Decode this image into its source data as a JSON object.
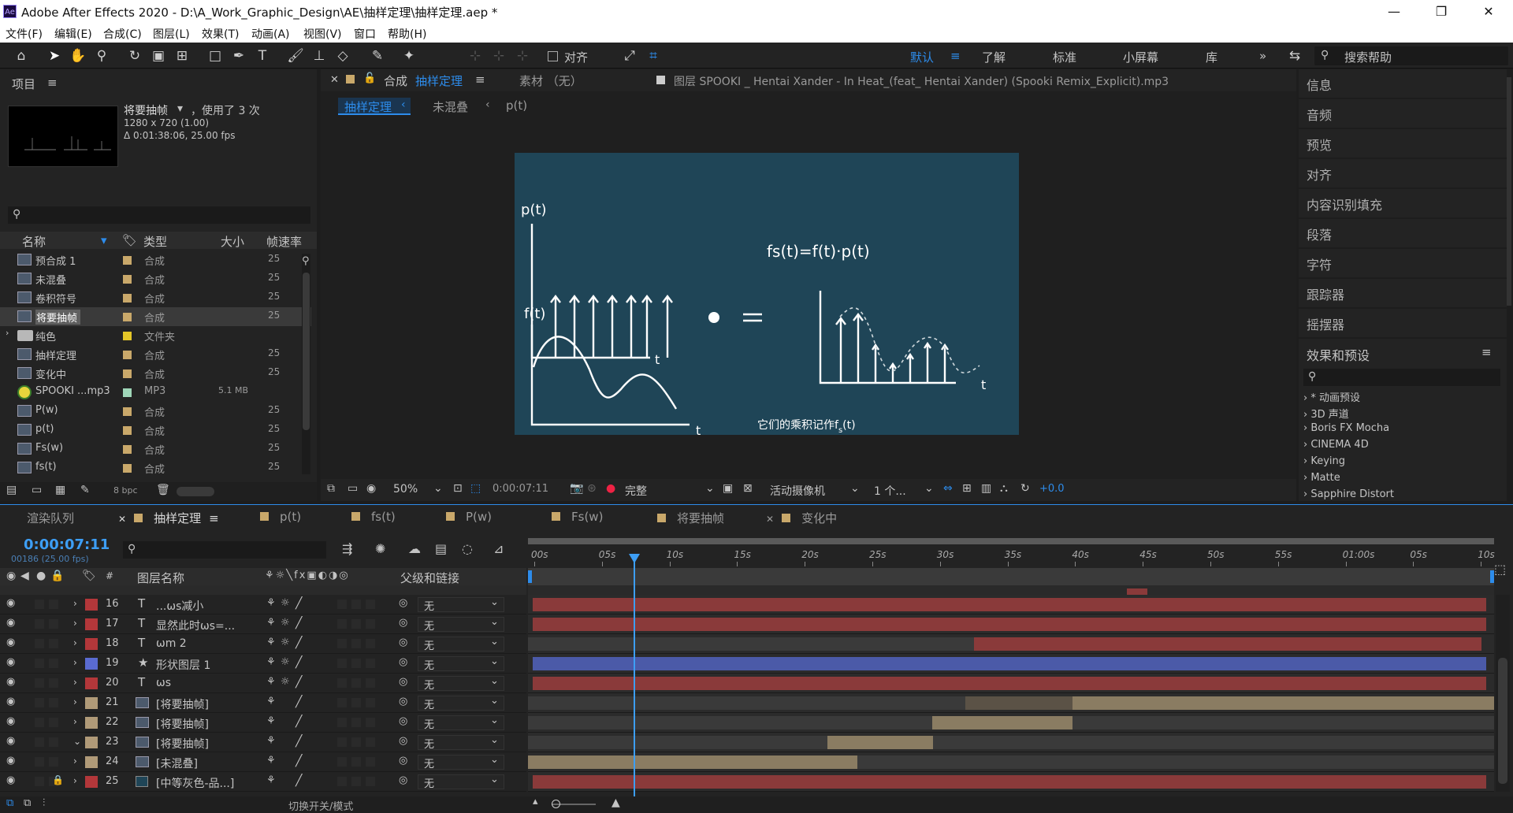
{
  "window": {
    "title": "Adobe After Effects 2020 - D:\\A_Work_Graphic_Design\\AE\\抽样定理\\抽样定理.aep *",
    "logo": "Ae"
  },
  "menu": [
    "文件(F)",
    "编辑(E)",
    "合成(C)",
    "图层(L)",
    "效果(T)",
    "动画(A)",
    "视图(V)",
    "窗口",
    "帮助(H)"
  ],
  "toolbar": {
    "align_label": "对齐",
    "workspaces": [
      "默认",
      "了解",
      "标准",
      "小屏幕",
      "库"
    ],
    "active_workspace": "默认",
    "search_placeholder": "搜索帮助"
  },
  "project": {
    "panel_title": "项目",
    "selected_name": "将要抽帧",
    "used": "，使用了 3 次",
    "resolution": "1280 x 720 (1.00)",
    "duration": "Δ 0:01:38:06, 25.00 fps",
    "columns": {
      "name": "名称",
      "type": "类型",
      "size": "大小",
      "fps": "帧速率"
    },
    "items": [
      {
        "name": "预合成 1",
        "type": "合成",
        "size": "",
        "fps": "25",
        "color": "#c9a86a",
        "icon": "comp"
      },
      {
        "name": "未混叠",
        "type": "合成",
        "size": "",
        "fps": "25",
        "color": "#c9a86a",
        "icon": "comp"
      },
      {
        "name": "卷积符号",
        "type": "合成",
        "size": "",
        "fps": "25",
        "color": "#c9a86a",
        "icon": "comp"
      },
      {
        "name": "将要抽帧",
        "type": "合成",
        "size": "",
        "fps": "25",
        "color": "#c9a86a",
        "icon": "comp",
        "selected": true
      },
      {
        "name": "纯色",
        "type": "文件夹",
        "size": "",
        "fps": "",
        "color": "#e4c628",
        "icon": "folder"
      },
      {
        "name": "抽样定理",
        "type": "合成",
        "size": "",
        "fps": "25",
        "color": "#c9a86a",
        "icon": "comp"
      },
      {
        "name": "变化中",
        "type": "合成",
        "size": "",
        "fps": "25",
        "color": "#c9a86a",
        "icon": "comp"
      },
      {
        "name": "SPOOKI ...mp3",
        "type": "MP3",
        "size": "5.1 MB",
        "fps": "",
        "color": "#9fd6b8",
        "icon": "audio"
      },
      {
        "name": "P(w)",
        "type": "合成",
        "size": "",
        "fps": "25",
        "color": "#c9a86a",
        "icon": "comp"
      },
      {
        "name": "p(t)",
        "type": "合成",
        "size": "",
        "fps": "25",
        "color": "#c9a86a",
        "icon": "comp"
      },
      {
        "name": "Fs(w)",
        "type": "合成",
        "size": "",
        "fps": "25",
        "color": "#c9a86a",
        "icon": "comp"
      },
      {
        "name": "fs(t)",
        "type": "合成",
        "size": "",
        "fps": "25",
        "color": "#c9a86a",
        "icon": "comp"
      }
    ],
    "bpc": "8 bpc"
  },
  "viewer": {
    "comp_tab_prefix": "合成",
    "comp_tab_name": "抽样定理",
    "footage_tab": "素材 （无）",
    "layer_tab": "图层 SPOOKI _ Hentai Xander - In Heat_(feat_ Hentai Xander) (Spooki Remix_Explicit).mp3",
    "breadcrumbs": [
      "抽样定理",
      "未混叠",
      "p(t)"
    ],
    "zoom": "50%",
    "timecode": "0:00:07:11",
    "quality": "完整",
    "camera": "活动摄像机",
    "views": "1 个...",
    "exposure": "+0.0"
  },
  "artwork": {
    "label_pt": "p(t)",
    "label_ft": "f(t)",
    "axis_t": "t",
    "formula": "fs(t)=f(t)·p(t)",
    "dot": "●",
    "equals": "=",
    "caption": "它们的乘积记作f",
    "caption_sub": "s",
    "caption_end": "(t)"
  },
  "right_panels": [
    "信息",
    "音频",
    "预览",
    "对齐",
    "内容识别填充",
    "段落",
    "字符",
    "跟踪器",
    "摇摆器"
  ],
  "effects": {
    "title": "效果和预设",
    "items": [
      "* 动画预设",
      "3D 声道",
      "Boris FX Mocha",
      "CINEMA 4D",
      "Keying",
      "Matte",
      "Sapphire Distort"
    ]
  },
  "timeline": {
    "tabs": [
      "渲染队列",
      "抽样定理",
      "p(t)",
      "fs(t)",
      "P(w)",
      "Fs(w)",
      "将要抽帧",
      "变化中"
    ],
    "active_tab": "抽样定理",
    "timecode": "0:00:07:11",
    "frame_info": "00186 (25.00 fps)",
    "col_layer": "图层名称",
    "col_parent": "父级和链接",
    "toggle_label": "切换开关/模式",
    "ruler": [
      "00s",
      "05s",
      "10s",
      "15s",
      "20s",
      "25s",
      "30s",
      "35s",
      "40s",
      "45s",
      "50s",
      "55s",
      "01:00s",
      "05s",
      "10s"
    ],
    "layers": [
      {
        "num": "16",
        "type": "T",
        "name": "...ωs减小",
        "label": "#b3373a",
        "parent": "无",
        "bar_color": "#8a3a3a"
      },
      {
        "num": "17",
        "type": "T",
        "name": "显然此时ωs=...",
        "label": "#b3373a",
        "parent": "无",
        "bar_color": "#8a3a3a"
      },
      {
        "num": "18",
        "type": "T",
        "name": "ωm 2",
        "label": "#b3373a",
        "parent": "无",
        "bar_color": "#8a3a3a"
      },
      {
        "num": "19",
        "type": "★",
        "name": "形状图层 1",
        "label": "#5a6bd1",
        "parent": "无",
        "bar_color": "#4b5aa8"
      },
      {
        "num": "20",
        "type": "T",
        "name": "ωs",
        "label": "#b3373a",
        "parent": "无",
        "bar_color": "#8a3a3a"
      },
      {
        "num": "21",
        "type": "comp",
        "name": "[将要抽帧]",
        "label": "#b09a78",
        "parent": "无",
        "bar_color": "#8a7c62"
      },
      {
        "num": "22",
        "type": "comp",
        "name": "[将要抽帧]",
        "label": "#b09a78",
        "parent": "无",
        "bar_color": "#8a7c62"
      },
      {
        "num": "23",
        "type": "comp",
        "name": "[将要抽帧]",
        "label": "#b09a78",
        "parent": "无",
        "bar_color": "#8a7c62"
      },
      {
        "num": "24",
        "type": "comp",
        "name": "[未混叠]",
        "label": "#b09a78",
        "parent": "无",
        "bar_color": "#8a7c62"
      },
      {
        "num": "25",
        "type": "solid",
        "name": "[中等灰色-品...]",
        "label": "#b3373a",
        "parent": "无",
        "bar_color": "#8a3a3a"
      }
    ]
  },
  "colors": {
    "accent": "#2d8ceb",
    "comp_bg": "#1f4557",
    "panel": "#232323"
  }
}
